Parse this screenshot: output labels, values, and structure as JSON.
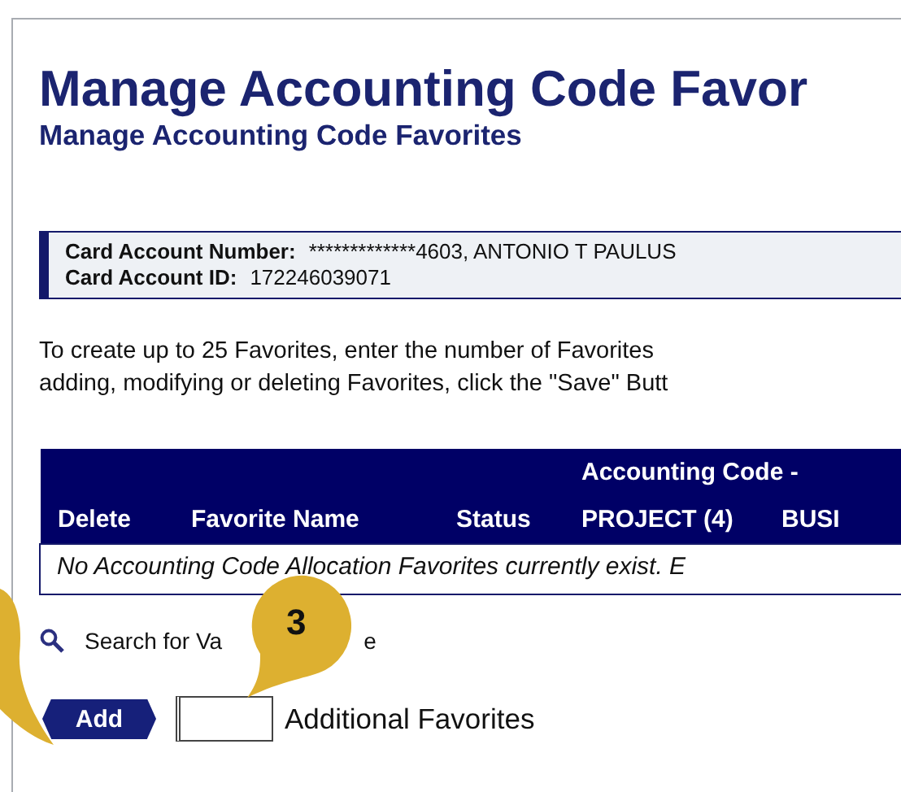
{
  "title": "Manage Accounting Code Favor",
  "subtitle": "Manage Accounting Code Favorites",
  "account": [
    {
      "label": "Card Account Number:",
      "value": "*************4603, ANTONIO T PAULUS"
    },
    {
      "label": "Card Account ID:",
      "value": "172246039071"
    }
  ],
  "instructions": [
    "To create up to 25 Favorites, enter the number of Favorites",
    "adding, modifying or deleting Favorites, click the \"Save\" Butt"
  ],
  "table": {
    "group_heading": "Accounting Code -",
    "columns": [
      "Delete",
      "Favorite Name",
      "Status",
      "PROJECT (4)",
      "BUSI"
    ],
    "empty_message": "No Accounting Code Allocation Favorites currently exist. E"
  },
  "search_link": {
    "visible_start": "Search for Va",
    "visible_end": "e"
  },
  "add_button": "Add",
  "additional_field": {
    "label": "Additional Favorites"
  },
  "callouts": [
    {
      "kind": "partial"
    },
    {
      "kind": "numbered",
      "number": "3"
    }
  ]
}
